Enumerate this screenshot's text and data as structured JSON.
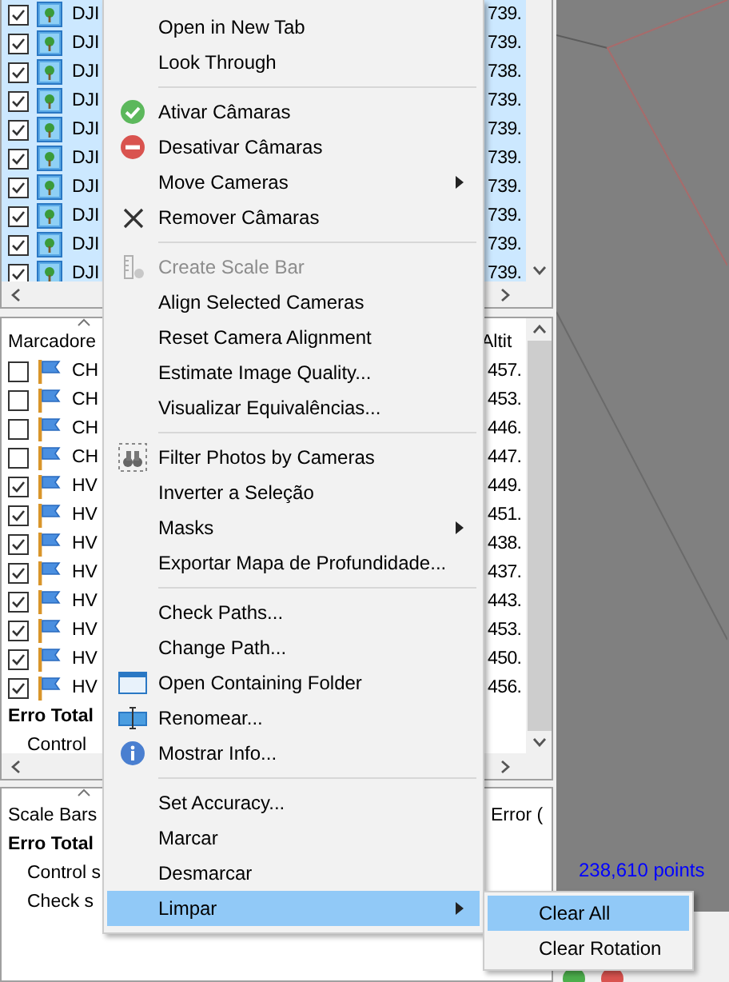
{
  "cameras": {
    "rows": [
      {
        "label": "DJI",
        "value": "739.",
        "checked": true,
        "selected": true
      },
      {
        "label": "DJI",
        "value": "739.",
        "checked": true,
        "selected": true
      },
      {
        "label": "DJI",
        "value": "738.",
        "checked": true,
        "selected": true
      },
      {
        "label": "DJI",
        "value": "739.",
        "checked": true,
        "selected": true
      },
      {
        "label": "DJI",
        "value": "739.",
        "checked": true,
        "selected": true
      },
      {
        "label": "DJI",
        "value": "739.",
        "checked": true,
        "selected": true
      },
      {
        "label": "DJI",
        "value": "739.",
        "checked": true,
        "selected": true
      },
      {
        "label": "DJI",
        "value": "739.",
        "checked": true,
        "selected": true
      },
      {
        "label": "DJI",
        "value": "739.",
        "checked": true,
        "selected": true
      },
      {
        "label": "DJI",
        "value": "739.",
        "checked": true,
        "selected": true
      }
    ]
  },
  "markers": {
    "columns": [
      "Marcadore",
      "Altit"
    ],
    "rows": [
      {
        "label": "CH",
        "value": "457.",
        "checked": false
      },
      {
        "label": "CH",
        "value": "453.",
        "checked": false
      },
      {
        "label": "CH",
        "value": "446.",
        "checked": false
      },
      {
        "label": "CH",
        "value": "447.",
        "checked": false
      },
      {
        "label": "HV",
        "value": "449.",
        "checked": true
      },
      {
        "label": "HV",
        "value": "451.",
        "checked": true
      },
      {
        "label": "HV",
        "value": "438.",
        "checked": true
      },
      {
        "label": "HV",
        "value": "437.",
        "checked": true
      },
      {
        "label": "HV",
        "value": "443.",
        "checked": true
      },
      {
        "label": "HV",
        "value": "453.",
        "checked": true
      },
      {
        "label": "HV",
        "value": "450.",
        "checked": true
      },
      {
        "label": "HV",
        "value": "456.",
        "checked": true
      }
    ],
    "summary": [
      {
        "label": "Erro Total",
        "kind": "total"
      },
      {
        "label": "Control",
        "kind": "item"
      }
    ]
  },
  "scale_bars": {
    "columns": [
      "Scale Bars",
      "Error ("
    ],
    "summary": [
      {
        "label": "Erro Total",
        "kind": "total"
      },
      {
        "label": "Control s",
        "kind": "item"
      },
      {
        "label": "Check s",
        "kind": "item"
      }
    ]
  },
  "viewport": {
    "status": "238,610 points"
  },
  "context_menu": {
    "items": [
      {
        "kind": "item",
        "label": "Open in New Tab",
        "disabled": false,
        "submenu": false,
        "selected": false
      },
      {
        "kind": "item",
        "label": "Look Through",
        "disabled": false,
        "submenu": false,
        "selected": false
      },
      {
        "kind": "separator"
      },
      {
        "kind": "item",
        "label": "Ativar Câmaras",
        "disabled": false,
        "submenu": false,
        "selected": false
      },
      {
        "kind": "item",
        "label": "Desativar Câmaras",
        "disabled": false,
        "submenu": false,
        "selected": false
      },
      {
        "kind": "item",
        "label": "Move Cameras",
        "disabled": false,
        "submenu": true,
        "selected": false
      },
      {
        "kind": "item",
        "label": "Remover Câmaras",
        "disabled": false,
        "submenu": false,
        "selected": false
      },
      {
        "kind": "separator"
      },
      {
        "kind": "item",
        "label": "Create Scale Bar",
        "disabled": true,
        "submenu": false,
        "selected": false
      },
      {
        "kind": "item",
        "label": "Align Selected Cameras",
        "disabled": false,
        "submenu": false,
        "selected": false
      },
      {
        "kind": "item",
        "label": "Reset Camera Alignment",
        "disabled": false,
        "submenu": false,
        "selected": false
      },
      {
        "kind": "item",
        "label": "Estimate Image Quality...",
        "disabled": false,
        "submenu": false,
        "selected": false
      },
      {
        "kind": "item",
        "label": "Visualizar Equivalências...",
        "disabled": false,
        "submenu": false,
        "selected": false
      },
      {
        "kind": "separator"
      },
      {
        "kind": "item",
        "label": "Filter Photos by Cameras",
        "disabled": false,
        "submenu": false,
        "selected": false
      },
      {
        "kind": "item",
        "label": "Inverter a Seleção",
        "disabled": false,
        "submenu": false,
        "selected": false
      },
      {
        "kind": "item",
        "label": "Masks",
        "disabled": false,
        "submenu": true,
        "selected": false
      },
      {
        "kind": "item",
        "label": "Exportar Mapa de Profundidade...",
        "disabled": false,
        "submenu": false,
        "selected": false
      },
      {
        "kind": "separator"
      },
      {
        "kind": "item",
        "label": "Check Paths...",
        "disabled": false,
        "submenu": false,
        "selected": false
      },
      {
        "kind": "item",
        "label": "Change Path...",
        "disabled": false,
        "submenu": false,
        "selected": false
      },
      {
        "kind": "item",
        "label": "Open Containing Folder",
        "disabled": false,
        "submenu": false,
        "selected": false
      },
      {
        "kind": "item",
        "label": "Renomear...",
        "disabled": false,
        "submenu": false,
        "selected": false
      },
      {
        "kind": "item",
        "label": "Mostrar Info...",
        "disabled": false,
        "submenu": false,
        "selected": false
      },
      {
        "kind": "separator"
      },
      {
        "kind": "item",
        "label": "Set Accuracy...",
        "disabled": false,
        "submenu": false,
        "selected": false
      },
      {
        "kind": "item",
        "label": "Marcar",
        "disabled": false,
        "submenu": false,
        "selected": false
      },
      {
        "kind": "item",
        "label": "Desmarcar",
        "disabled": false,
        "submenu": false,
        "selected": false
      },
      {
        "kind": "item",
        "label": "Limpar",
        "disabled": false,
        "submenu": true,
        "selected": true
      }
    ]
  },
  "submenu": {
    "items": [
      {
        "label": "Clear All",
        "selected": true
      },
      {
        "label": "Clear Rotation",
        "selected": false
      }
    ]
  }
}
